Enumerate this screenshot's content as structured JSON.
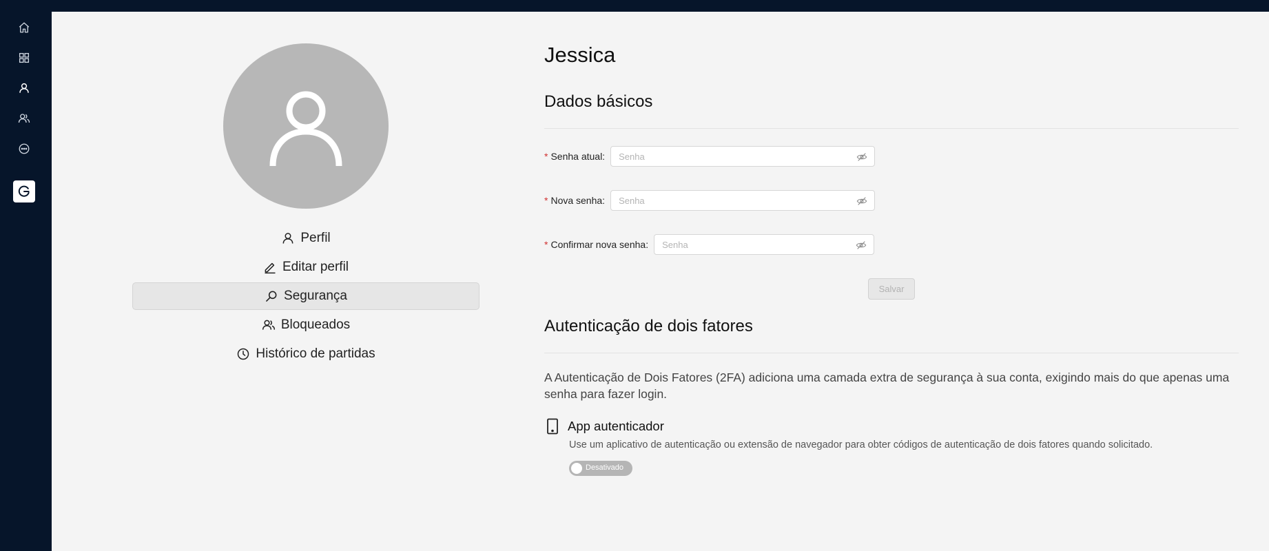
{
  "sidebar": {
    "icons": [
      "home-icon",
      "dashboard-icon",
      "user-icon",
      "friends-icon",
      "chat-icon"
    ],
    "logo": "app-logo-icon"
  },
  "profile": {
    "avatar_icon": "user-avatar-icon",
    "menu": [
      {
        "label": "Perfil",
        "icon": "user-icon"
      },
      {
        "label": "Editar perfil",
        "icon": "pencil-icon"
      },
      {
        "label": "Segurança",
        "icon": "magnifier-icon",
        "active": true
      },
      {
        "label": "Bloqueados",
        "icon": "users-blocked-icon"
      },
      {
        "label": "Histórico de partidas",
        "icon": "clock-icon"
      }
    ]
  },
  "main": {
    "user_name": "Jessica",
    "basic_section_title": "Dados básicos",
    "fields": [
      {
        "label": "Senha atual:",
        "placeholder": "Senha",
        "required": true
      },
      {
        "label": "Nova senha:",
        "placeholder": "Senha",
        "required": true
      },
      {
        "label": "Confirmar nova senha:",
        "placeholder": "Senha",
        "required": true
      }
    ],
    "required_mark": "*",
    "save_label": "Salvar",
    "twofa_title": "Autenticação de dois fatores",
    "twofa_description": "A Autenticação de Dois Fatores (2FA) adiciona uma camada extra de segurança à sua conta, exigindo mais do que apenas uma senha para fazer login.",
    "authenticator": {
      "title": "App autenticador",
      "subtitle": "Use um aplicativo de autenticação ou extensão de navegador para obter códigos de autenticação de dois fatores quando solicitado.",
      "toggle_label": "Desativado",
      "enabled": false
    }
  },
  "colors": {
    "sidebar_bg": "#06152a",
    "page_bg": "#f4f4f4",
    "required": "#d03030",
    "avatar_bg": "#b7b7b7"
  }
}
